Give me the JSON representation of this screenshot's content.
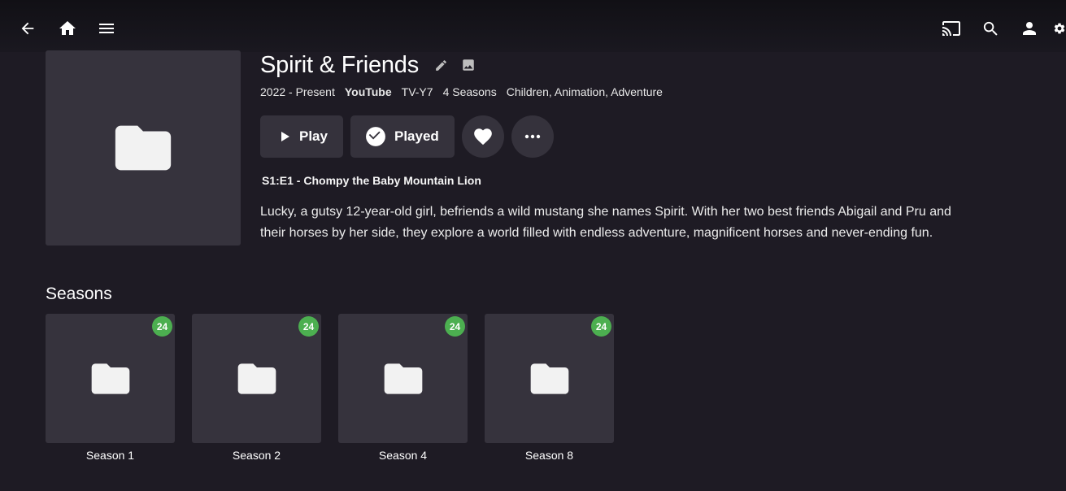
{
  "show": {
    "title": "Spirit & Friends",
    "years": "2022 - Present",
    "network": "YouTube",
    "rating": "TV-Y7",
    "season_count": "4 Seasons",
    "genres": "Children, Animation, Adventure",
    "next_episode": "S1:E1 - Chompy the Baby Mountain Lion",
    "overview": "Lucky, a gutsy 12-year-old girl, befriends a wild mustang she names Spirit. With her two best friends Abigail and Pru and their horses by her side, they explore a world filled with endless adventure, magnificent horses and never-ending fun."
  },
  "actions": {
    "play_label": "Play",
    "played_label": "Played"
  },
  "seasons": {
    "title": "Seasons",
    "items": [
      {
        "label": "Season 1",
        "badge": "24"
      },
      {
        "label": "Season 2",
        "badge": "24"
      },
      {
        "label": "Season 4",
        "badge": "24"
      },
      {
        "label": "Season 8",
        "badge": "24"
      }
    ]
  },
  "icons": {
    "back": "arrow-back-icon",
    "home": "home-icon",
    "menu": "menu-icon",
    "cast": "cast-icon",
    "search": "search-icon",
    "user": "person-icon",
    "settings": "gear-icon",
    "edit": "pencil-icon",
    "image": "image-icon",
    "folder": "folder-icon",
    "heart": "heart-icon",
    "more": "more-horiz-icon"
  },
  "colors": {
    "background": "#1e1b24",
    "card": "#36333d",
    "button": "#35323c",
    "badge": "#4caf50"
  }
}
